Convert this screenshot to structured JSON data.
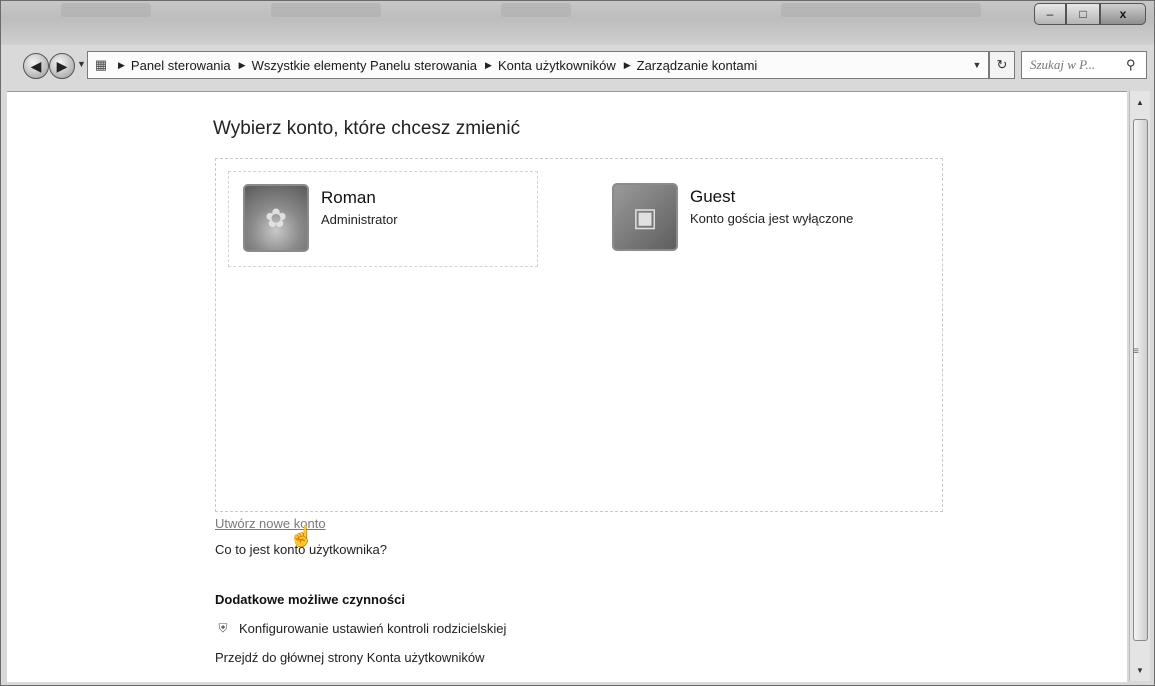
{
  "window": {
    "minimize_glyph": "–",
    "maximize_glyph": "□",
    "close_glyph": "x"
  },
  "nav": {
    "back_glyph": "◀",
    "forward_glyph": "▶",
    "recent_glyph": "▼",
    "address_icon": "control-panel-icon",
    "breadcrumbs": [
      "Panel sterowania",
      "Wszystkie elementy Panelu sterowania",
      "Konta użytkowników",
      "Zarządzanie kontami"
    ],
    "separator_glyph": "▶",
    "dropdown_glyph": "▼",
    "refresh_glyph": "↻",
    "search_placeholder": "Szukaj w P...",
    "search_glyph": "⚲"
  },
  "main": {
    "heading": "Wybierz konto, które chcesz zmienić",
    "accounts": [
      {
        "name": "Roman",
        "role": "Administrator",
        "avatar_icon": "flower-avatar-icon"
      },
      {
        "name": "Guest",
        "role": "Konto gościa jest wyłączone",
        "avatar_icon": "briefcase-avatar-icon"
      }
    ],
    "create_link": "Utwórz nowe konto",
    "what_link": "Co to jest konto użytkownika?",
    "extra_heading": "Dodatkowe możliwe czynności",
    "parental_link": "Konfigurowanie ustawień kontroli rodzicielskiej",
    "main_page_link": "Przejdź do głównej strony Konta użytkowników"
  },
  "scrollbar": {
    "up_glyph": "▲",
    "down_glyph": "▼",
    "grip_glyph": "≡"
  }
}
